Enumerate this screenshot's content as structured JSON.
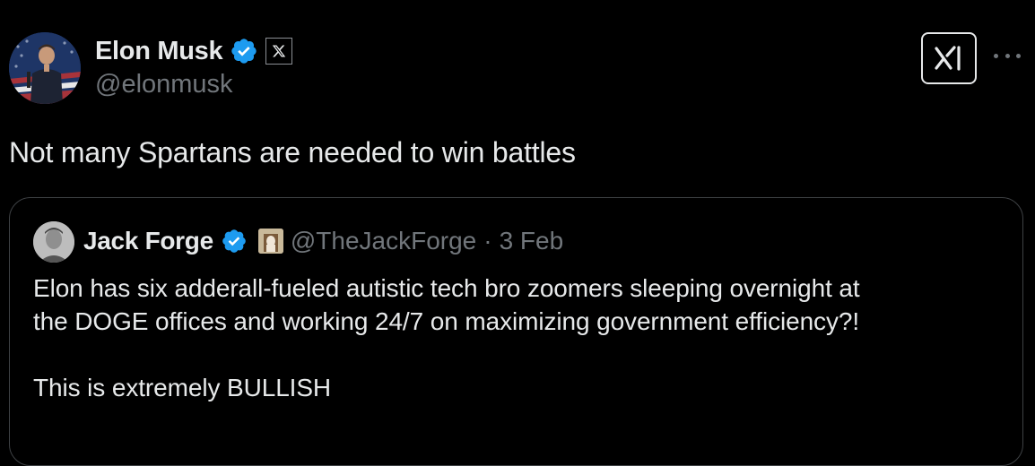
{
  "post": {
    "author": {
      "display_name": "Elon Musk",
      "handle": "@elonmusk"
    },
    "text": "Not many Spartans are needed to win battles"
  },
  "quote": {
    "author": {
      "display_name": "Jack Forge",
      "handle": "@TheJackForge"
    },
    "separator": "·",
    "date": "3 Feb",
    "lines": [
      "Elon has six adderall-fueled autistic tech bro zoomers sleeping overnight at",
      "the DOGE offices and working 24/7 on maximizing government efficiency?!"
    ],
    "last_paragraph": "This is extremely BULLISH"
  },
  "colors": {
    "verified": "#1d9bf0",
    "background": "#000000",
    "secondary_text": "#71767b"
  },
  "icons": [
    "verified-badge-icon",
    "x-affiliate-badge-icon",
    "grok-icon",
    "more-icon",
    "emoji-badge-icon"
  ]
}
